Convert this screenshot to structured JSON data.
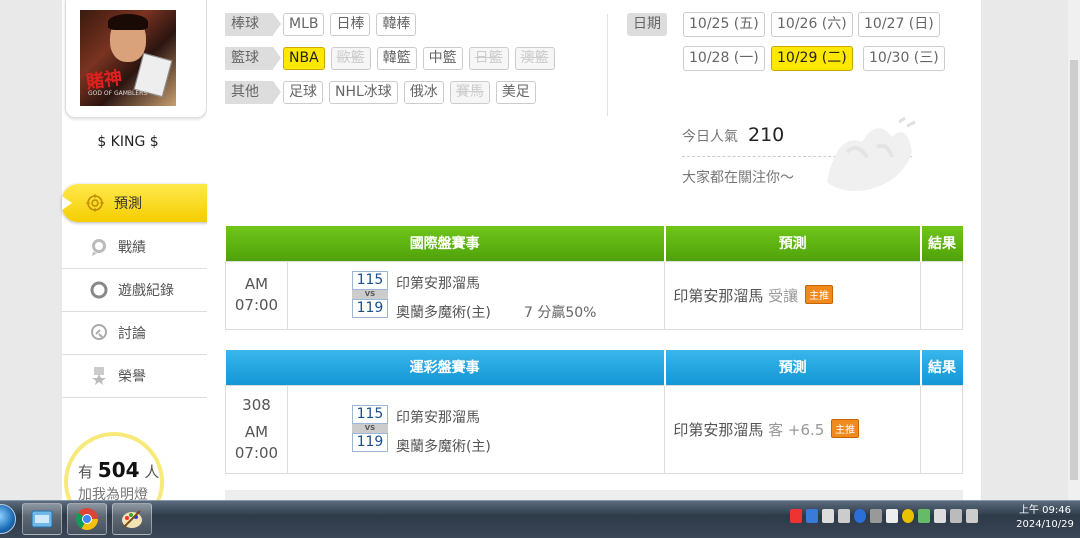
{
  "sidebar": {
    "avatar_title": "賭神",
    "avatar_subtitle": "GOD OF GAMBLERS",
    "username": "$ KING $",
    "nav": [
      {
        "label": "預測",
        "icon": "target-icon"
      },
      {
        "label": "戰績",
        "icon": "chat-bubble-icon"
      },
      {
        "label": "遊戲紀錄",
        "icon": "ring-icon"
      },
      {
        "label": "討論",
        "icon": "magnifier-icon"
      },
      {
        "label": "榮譽",
        "icon": "medal-icon"
      }
    ],
    "fans": {
      "prefix": "有",
      "count": "504",
      "suffix": "人",
      "line2": "加我為明燈"
    }
  },
  "filters": {
    "baseball": {
      "label": "棒球",
      "items": [
        "MLB",
        "日棒",
        "韓棒"
      ]
    },
    "basketball": {
      "label": "籃球",
      "items": [
        "NBA",
        "歐籃",
        "韓籃",
        "中籃",
        "日籃",
        "澳籃"
      ]
    },
    "other": {
      "label": "其他",
      "items": [
        "足球",
        "NHL冰球",
        "俄冰",
        "賽馬",
        "美足"
      ]
    }
  },
  "dates": {
    "label": "日期",
    "row1": [
      "10/25 (五)",
      "10/26 (六)",
      "10/27 (日)"
    ],
    "row2": [
      "10/28 (一)",
      "10/29 (二)",
      "10/30 (三)"
    ]
  },
  "popularity": {
    "label": "今日人氣",
    "value": "210",
    "watching": "大家都在關注你～"
  },
  "international": {
    "headers": [
      "國際盤賽事",
      "預測",
      "結果"
    ],
    "time_line1": "AM",
    "time_line2": "07:00",
    "score_top": "115",
    "vs": "VS",
    "score_bottom": "119",
    "team_top": "印第安那溜馬",
    "team_bottom": "奧蘭多魔術(主)",
    "note": "7 分贏50%",
    "pick_team": "印第安那溜馬",
    "pick_type": "受讓",
    "badge": "主推",
    "result": ""
  },
  "sports_lottery": {
    "headers": [
      "運彩盤賽事",
      "預測",
      "結果"
    ],
    "game_no": "308",
    "time_line1": "AM",
    "time_line2": "07:00",
    "score_top": "115",
    "vs": "VS",
    "score_bottom": "119",
    "team_top": "印第安那溜馬",
    "team_bottom": "奧蘭多魔術(主)",
    "pick_team": "印第安那溜馬",
    "pick_type": "客 +6.5",
    "badge": "主推",
    "result": ""
  },
  "taskbar": {
    "clock_time": "上午 09:46",
    "clock_date": "2024/10/29",
    "apps": [
      "explorer-icon",
      "chrome-icon",
      "paint-icon"
    ]
  },
  "colors": {
    "green_header": "#5cb512",
    "blue_header": "#1ea4e0",
    "active_chip": "#ffe800",
    "badge": "#f08a1c"
  }
}
